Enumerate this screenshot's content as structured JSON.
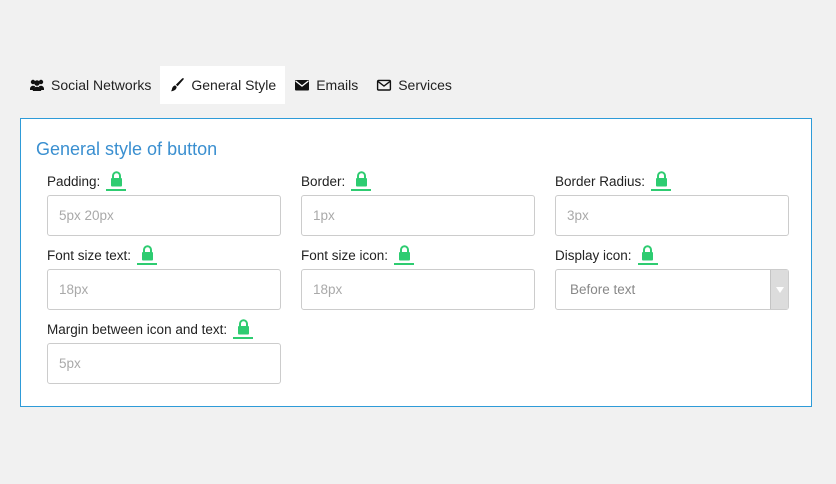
{
  "tabs": [
    {
      "label": "Social Networks",
      "icon": "users-icon",
      "active": false
    },
    {
      "label": "General Style",
      "icon": "brush-icon",
      "active": true
    },
    {
      "label": "Emails",
      "icon": "envelope-icon",
      "active": false
    },
    {
      "label": "Services",
      "icon": "envelope-outline-icon",
      "active": false
    }
  ],
  "panel": {
    "title": "General style of button",
    "fields": {
      "padding": {
        "label": "Padding:",
        "placeholder": "5px 20px"
      },
      "border": {
        "label": "Border:",
        "placeholder": "1px"
      },
      "border_radius": {
        "label": "Border Radius:",
        "placeholder": "3px"
      },
      "font_size_text": {
        "label": "Font size text:",
        "placeholder": "18px"
      },
      "font_size_icon": {
        "label": "Font size icon:",
        "placeholder": "18px"
      },
      "display_icon": {
        "label": "Display icon:",
        "selected": "Before text"
      },
      "margin": {
        "label": "Margin between icon and text:",
        "placeholder": "5px"
      }
    }
  },
  "colors": {
    "accent_border": "#2e9bd8",
    "title": "#3a8fd0",
    "lock": "#2ecc71"
  }
}
